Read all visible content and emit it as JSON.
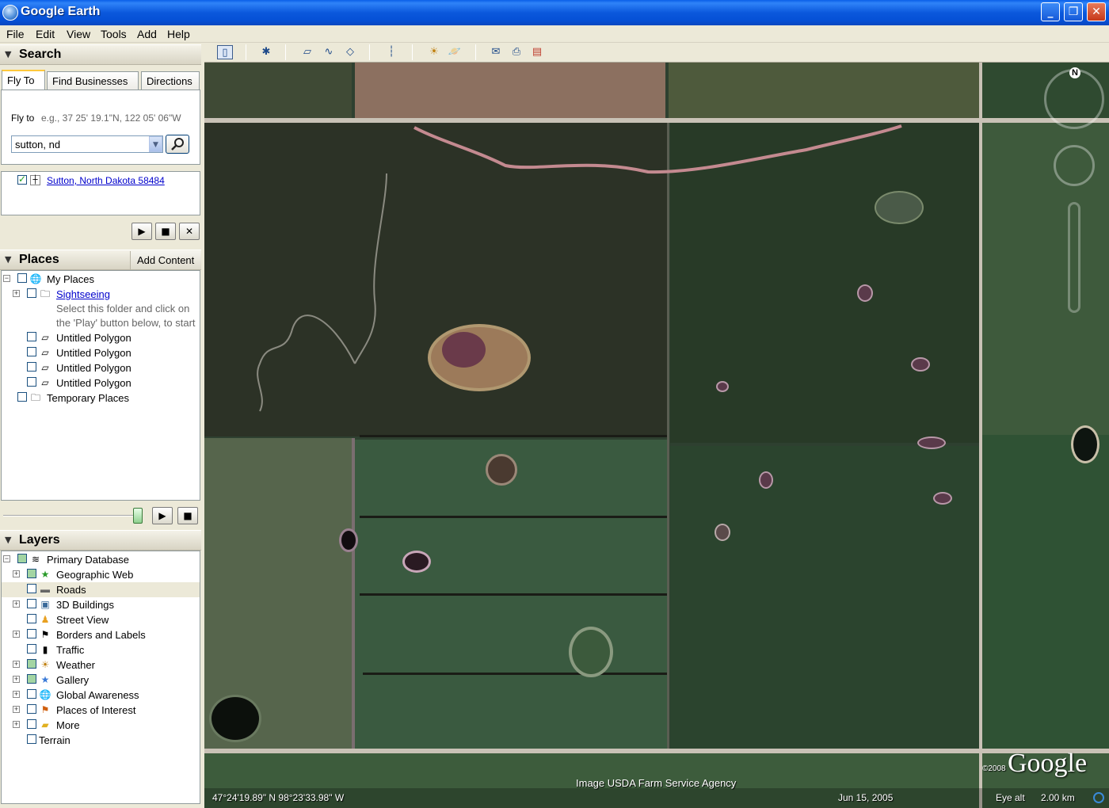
{
  "window": {
    "title": "Google Earth",
    "minimize": "_",
    "maximize": "❐",
    "close": "✕"
  },
  "menu": [
    "File",
    "Edit",
    "View",
    "Tools",
    "Add",
    "Help"
  ],
  "search": {
    "header": "Search",
    "tabs": [
      "Fly To",
      "Find Businesses",
      "Directions"
    ],
    "fly_label": "Fly to",
    "fly_placeholder": "e.g., 37 25' 19.1\"N, 122 05' 06\"W",
    "fly_value": "sutton, nd",
    "result": "Sutton, North Dakota 58484"
  },
  "places": {
    "header": "Places",
    "add_content": "Add Content",
    "items": [
      {
        "label": "My Places"
      },
      {
        "label": "Sightseeing"
      },
      {
        "label": "Select this folder and click on"
      },
      {
        "label": "the 'Play' button below, to start"
      },
      {
        "label": "Untitled Polygon"
      },
      {
        "label": "Untitled Polygon"
      },
      {
        "label": "Untitled Polygon"
      },
      {
        "label": "Untitled Polygon"
      },
      {
        "label": "Temporary Places"
      }
    ]
  },
  "layers": {
    "header": "Layers",
    "items": [
      {
        "label": "Primary Database"
      },
      {
        "label": "Geographic Web"
      },
      {
        "label": "Roads"
      },
      {
        "label": "3D Buildings"
      },
      {
        "label": "Street View"
      },
      {
        "label": "Borders and Labels"
      },
      {
        "label": "Traffic"
      },
      {
        "label": "Weather"
      },
      {
        "label": "Gallery"
      },
      {
        "label": "Global Awareness"
      },
      {
        "label": "Places of Interest"
      },
      {
        "label": "More"
      },
      {
        "label": "Terrain"
      }
    ]
  },
  "map": {
    "compass_north": "N",
    "coords": "47°24'19.89\" N  98°23'33.98\" W",
    "credit": "Image USDA Farm Service Agency",
    "date": "Jun 15, 2005",
    "eye_alt_label": "Eye alt",
    "eye_alt_value": "2.00 km",
    "copyright_year": "©2008",
    "logo": "Google"
  },
  "colors": {
    "titlebar": "#0b58dc",
    "link": "#0000cc",
    "panel": "#ece9d8"
  }
}
